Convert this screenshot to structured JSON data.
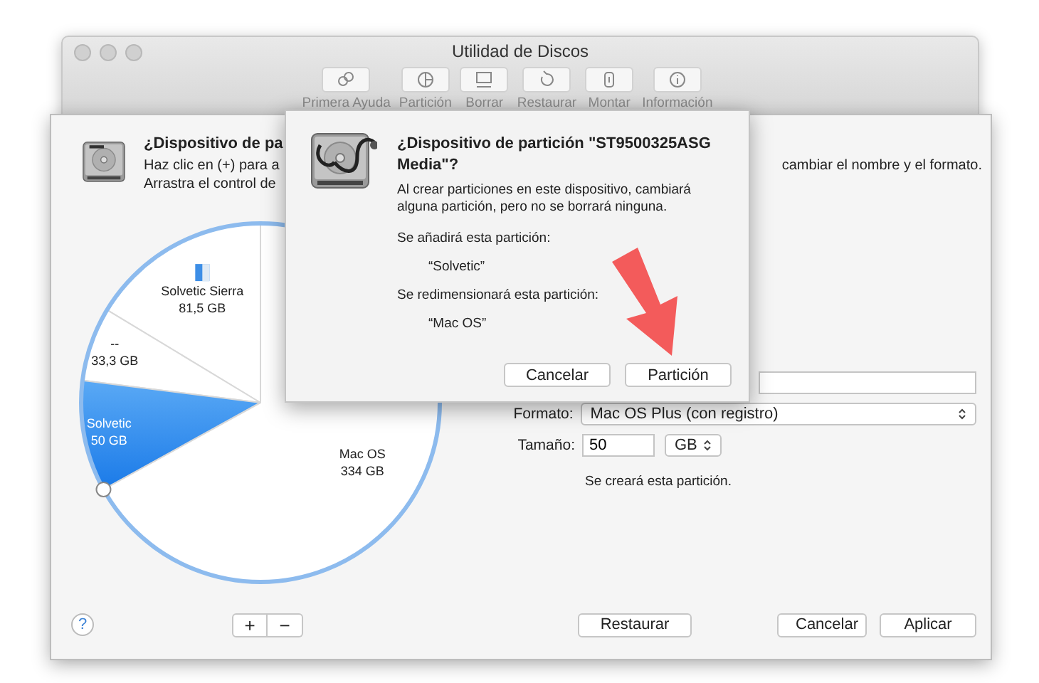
{
  "window": {
    "title": "Utilidad de Discos",
    "toolbar": [
      {
        "kind": "first_aid",
        "label": "Primera Ayuda"
      },
      {
        "kind": "partition",
        "label": "Partición"
      },
      {
        "kind": "erase",
        "label": "Borrar"
      },
      {
        "kind": "restore",
        "label": "Restaurar"
      },
      {
        "kind": "mount",
        "label": "Montar"
      },
      {
        "kind": "info",
        "label": "Información"
      }
    ]
  },
  "sheet": {
    "title": "¿Dispositivo de pa",
    "description_lines": [
      "Haz clic en (+) para a",
      "Arrastra el control de"
    ],
    "description_tail": "cambiar el nombre y el formato.",
    "partition_map": {
      "chart_data": {
        "type": "pie",
        "categories": [
          "Solvetic Sierra",
          "--",
          "Solvetic",
          "Mac OS"
        ],
        "values": [
          81.5,
          33.3,
          50,
          334
        ],
        "value_labels": [
          "81,5 GB",
          "33,3 GB",
          "50 GB",
          "334 GB"
        ]
      },
      "slices": [
        {
          "selected": false,
          "has_icon": true
        },
        {
          "selected": false,
          "has_icon": false
        },
        {
          "selected": true,
          "has_icon": false
        },
        {
          "selected": false,
          "has_icon": false
        }
      ]
    },
    "form": {
      "format_label": "Formato:",
      "format": "Mac OS Plus (con registro)",
      "size_label": "Tamaño:",
      "size": "50",
      "unit": "GB",
      "note": "Se creará esta partición."
    },
    "footer": {
      "help": "?",
      "add": "+",
      "remove": "−",
      "restore": "Restaurar",
      "cancel": "Cancelar",
      "apply": "Aplicar"
    }
  },
  "dialog": {
    "title": "¿Dispositivo de partición \"ST9500325ASG Media\"?",
    "message": "Al crear particiones en este dispositivo, cambiará alguna partición, pero no se borrará ninguna.",
    "add_label": "Se añadirá esta partición:",
    "added": "“Solvetic”",
    "resize_label": "Se redimensionará esta partición:",
    "resized": "“Mac OS”",
    "buttons": [
      "Cancelar",
      "Partición"
    ]
  }
}
